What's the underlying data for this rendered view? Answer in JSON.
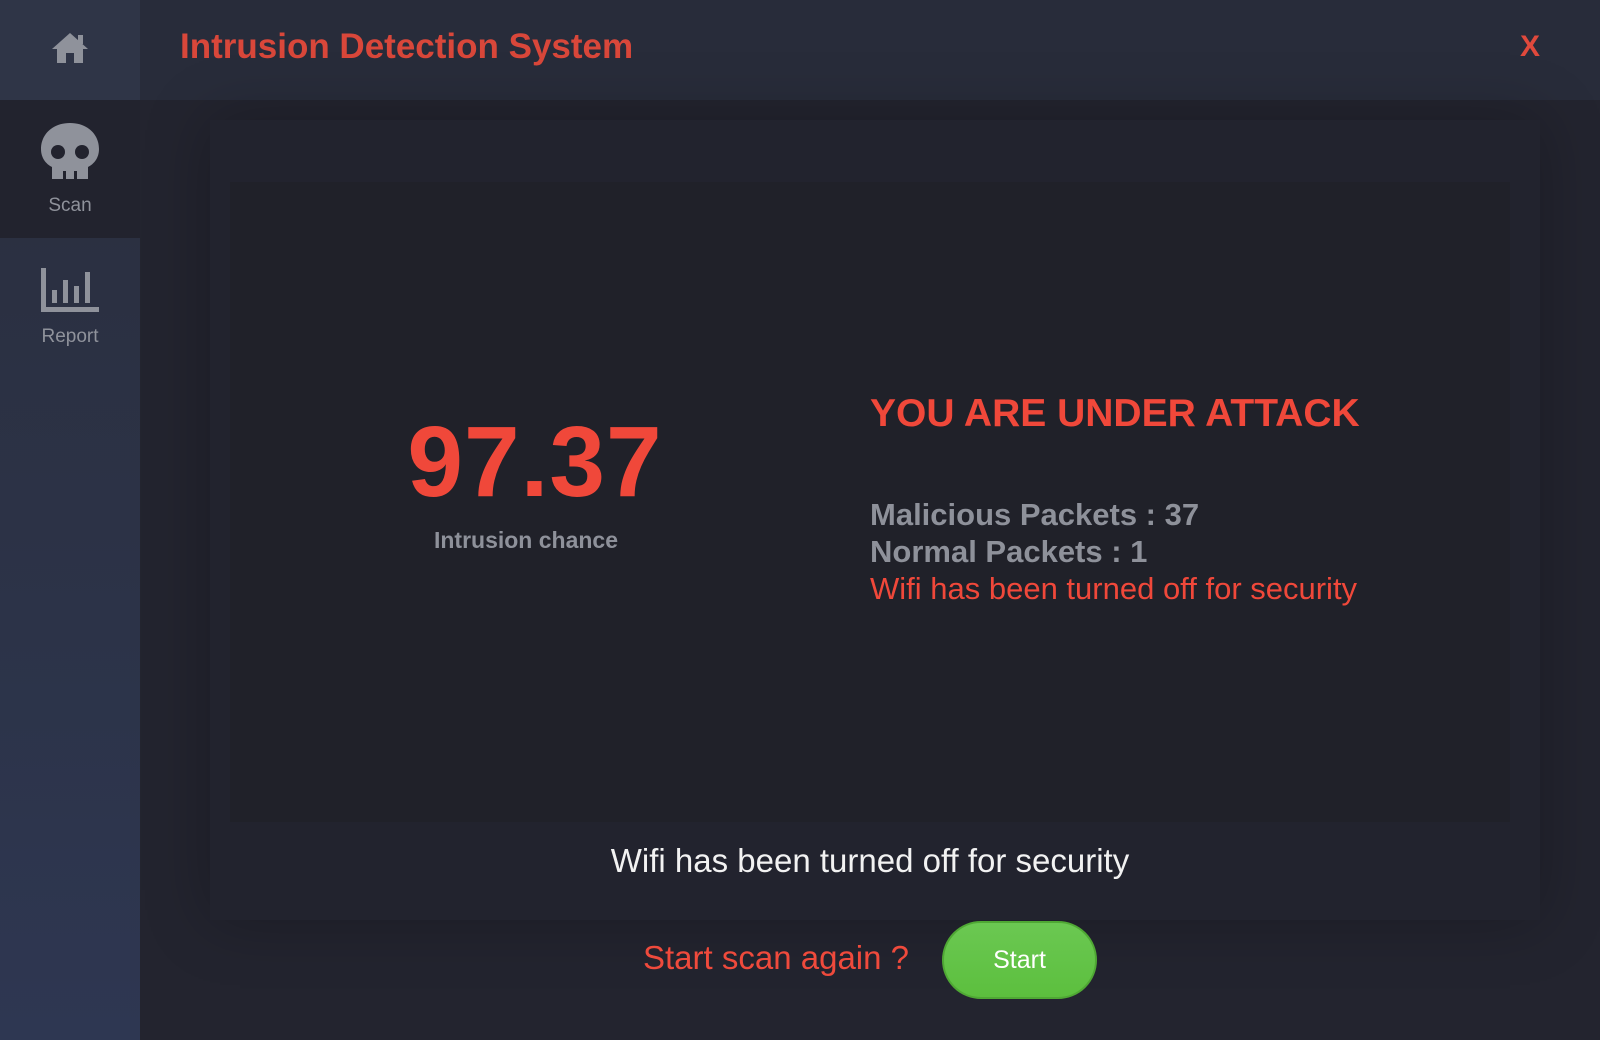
{
  "window": {
    "title": "Intrusion Detection System",
    "close_label": "X"
  },
  "sidebar": {
    "items": [
      {
        "name": "home",
        "label": "",
        "icon": "home-icon"
      },
      {
        "name": "scan",
        "label": "Scan",
        "icon": "skull-icon",
        "active": true
      },
      {
        "name": "report",
        "label": "Report",
        "icon": "bar-chart-icon"
      }
    ]
  },
  "result": {
    "intrusion_value": "97.37",
    "intrusion_label": "Intrusion chance",
    "status_title": "YOU ARE UNDER ATTACK",
    "malicious_packets": "Malicious Packets : 37",
    "normal_packets": "Normal Packets : 1",
    "wifi_notice": "Wifi has been turned off for security"
  },
  "footer": {
    "wifi_notice": "Wifi has been turned off for security",
    "rescan_prompt": "Start scan again ?",
    "start_label": "Start"
  },
  "colors": {
    "accent_red": "#f0483a",
    "start_green": "#5cbf3e",
    "muted_text": "#8e919a"
  }
}
